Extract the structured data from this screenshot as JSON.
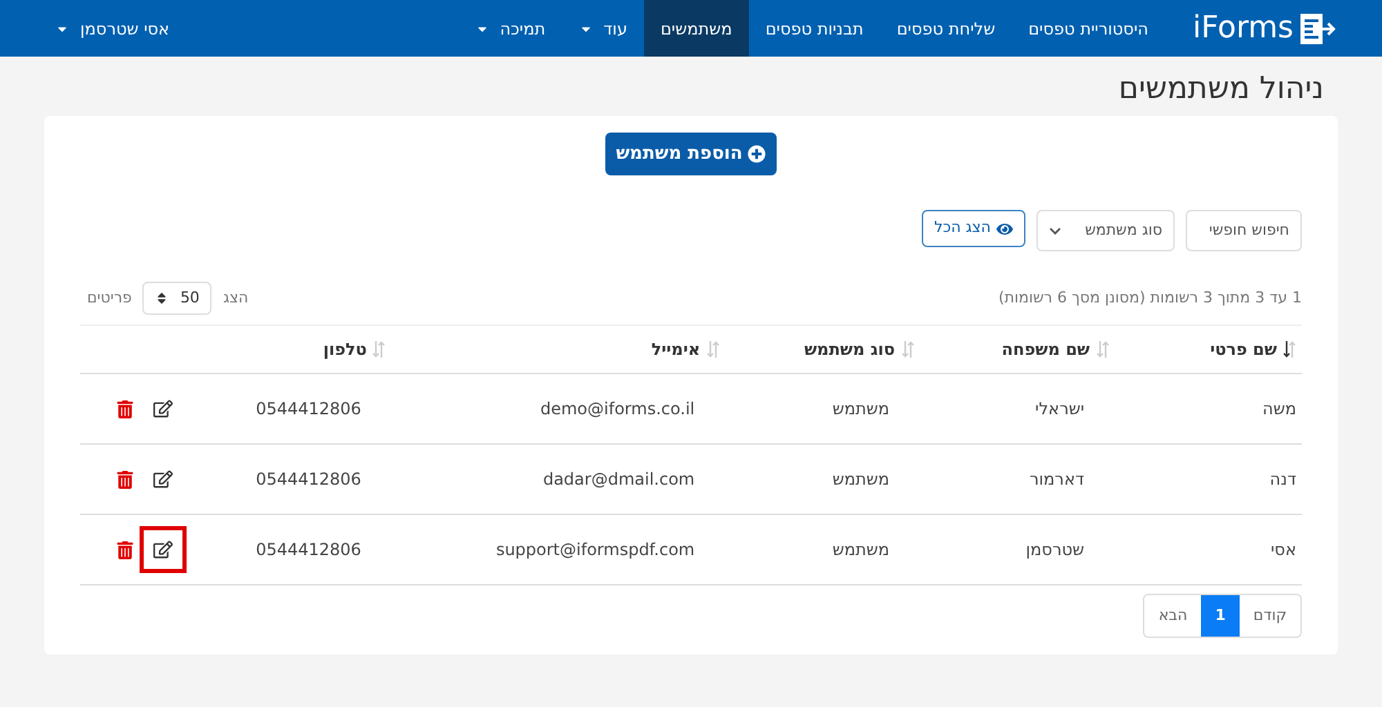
{
  "navbar": {
    "logo": "iForms",
    "items": [
      {
        "label": "היסטוריית טפסים",
        "selected": false,
        "dropdown": false
      },
      {
        "label": "שליחת טפסים",
        "selected": false,
        "dropdown": false
      },
      {
        "label": "תבניות טפסים",
        "selected": false,
        "dropdown": false
      },
      {
        "label": "משתמשים",
        "selected": true,
        "dropdown": false
      },
      {
        "label": "עוד",
        "selected": false,
        "dropdown": true
      },
      {
        "label": "תמיכה",
        "selected": false,
        "dropdown": true
      }
    ],
    "user": "אסי שטרסמן"
  },
  "page_title": "ניהול משתמשים",
  "add_button": "הוספת משתמש",
  "filters": {
    "search_placeholder": "חיפוש חופשי",
    "user_type": "סוג משתמש",
    "show_all": "הצג הכל"
  },
  "info": "1 עד 3 מתוך 3 רשומות (מסונן מסך 6 רשומות)",
  "page_length": {
    "before": "הצג",
    "value": "50",
    "after": "פריטים"
  },
  "table": {
    "columns": [
      {
        "label": "שם פרטי",
        "sorted": true
      },
      {
        "label": "שם משפחה",
        "sorted": false
      },
      {
        "label": "סוג משתמש",
        "sorted": false
      },
      {
        "label": "אימייל",
        "sorted": false
      },
      {
        "label": "טלפון",
        "sorted": false
      }
    ],
    "rows": [
      {
        "cells": [
          "משה",
          "ישראלי",
          "משתמש",
          "demo@iforms.co.il",
          "0544412806"
        ],
        "highlighted": false
      },
      {
        "cells": [
          "דנה",
          "דארמור",
          "משתמש",
          "dadar@dmail.com",
          "0544412806"
        ],
        "highlighted": false
      },
      {
        "cells": [
          "אסי",
          "שטרסמן",
          "משתמש",
          "support@iformspdf.com",
          "0544412806"
        ],
        "highlighted": true
      }
    ]
  },
  "pagination": [
    {
      "label": "קודם",
      "selected": false
    },
    {
      "label": "1",
      "selected": true
    },
    {
      "label": "הבא",
      "selected": false
    }
  ]
}
